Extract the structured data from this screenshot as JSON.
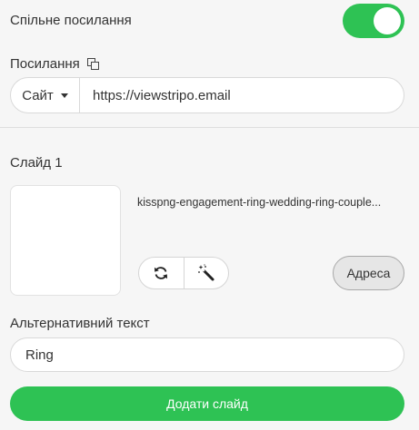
{
  "shared_link": {
    "label": "Спільне посилання",
    "toggle_on": true
  },
  "link": {
    "label": "Посилання",
    "type_selected": "Сайт",
    "url_value": "https://viewstripo.email"
  },
  "slide": {
    "title": "Слайд 1",
    "filename": "kisspng-engagement-ring-wedding-ring-couple...",
    "address_button": "Адреса"
  },
  "alt_text": {
    "label": "Альтернативний текст",
    "value": "Ring"
  },
  "add_slide_button": "Додати слайд",
  "colors": {
    "accent": "#2ec254",
    "background": "#f6f6f6"
  },
  "icons": [
    "copy-icon",
    "caret-down-icon",
    "refresh-icon",
    "magic-wand-icon"
  ]
}
